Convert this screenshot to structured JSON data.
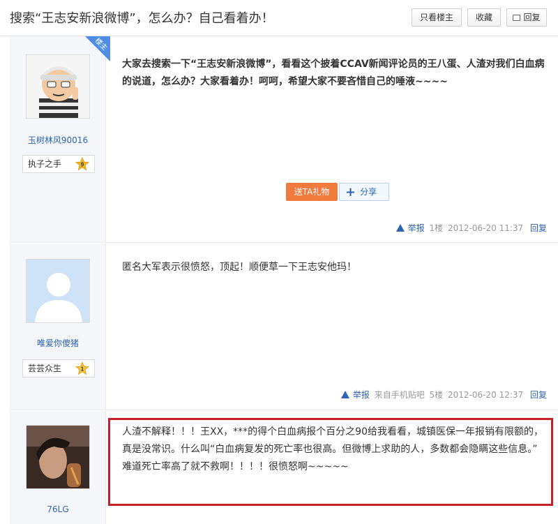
{
  "header": {
    "title": "搜索“王志安新浪微博”，怎么办？自己看着办！",
    "buttons": {
      "only_op": "只看楼主",
      "favorite": "收藏",
      "reply": "回复"
    }
  },
  "posts": [
    {
      "floor_badge": "楼主",
      "author": "玉树林风90016",
      "rank_title": "执子之手",
      "rank_level": "9",
      "content": "大家去搜索一下“王志安新浪微博”，看看这个披着CCAV新闻评论员的王八蛋、人渣对我们白血病的说道，怎么办？大家看着办！呵呵，希望大家不要吝惜自己的唾液~~~~",
      "gift_label": "送TA礼物",
      "share_label": "分享",
      "report_label": "举报",
      "source": "",
      "floor": "1楼",
      "time": "2012-06-20 11:37",
      "reply_label": "回复"
    },
    {
      "author": "唯爱你傻猪",
      "rank_title": "芸芸众生",
      "rank_level": "1",
      "content": "匿名大军表示很愤怒，顶起！顺便草一下王志安他玛！",
      "report_label": "举报",
      "source": "来自手机贴吧",
      "floor": "5楼",
      "time": "2012-06-20 12:37",
      "reply_label": "回复"
    },
    {
      "author": "76LG",
      "content": "人渣不解释！！！王XX，***的得个白血病报个百分之90给我看看，城镇医保一年报销有限额的，真是没常识。什么叫“白血病复发的死亡率也很高。但微博上求助的人，多数都会隐瞒这些信息。” 难道死亡率高了就不救啊！！！！很愤怒啊~~~~~"
    }
  ],
  "colors": {
    "link": "#2d64b3",
    "gift": "#f07b3f",
    "highlight": "#c8202a",
    "owner_badge": "#4f8de4"
  }
}
